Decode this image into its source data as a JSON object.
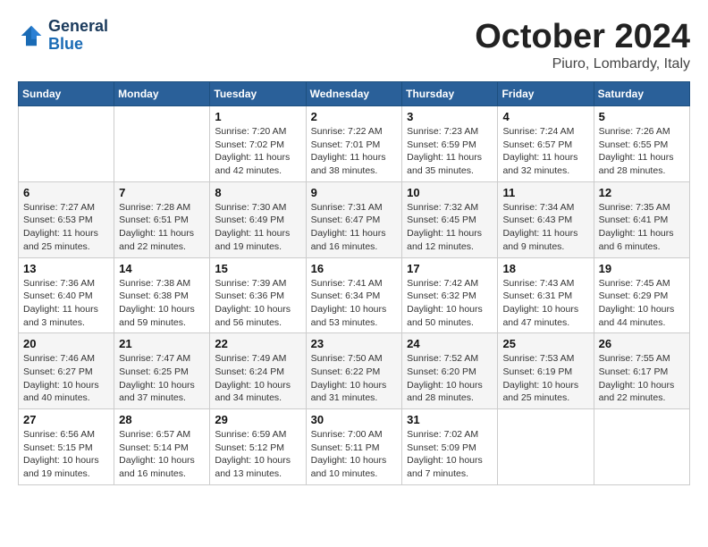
{
  "header": {
    "logo_line1": "General",
    "logo_line2": "Blue",
    "month_title": "October 2024",
    "location": "Piuro, Lombardy, Italy"
  },
  "calendar": {
    "days_of_week": [
      "Sunday",
      "Monday",
      "Tuesday",
      "Wednesday",
      "Thursday",
      "Friday",
      "Saturday"
    ],
    "weeks": [
      [
        {
          "day": "",
          "info": ""
        },
        {
          "day": "",
          "info": ""
        },
        {
          "day": "1",
          "info": "Sunrise: 7:20 AM\nSunset: 7:02 PM\nDaylight: 11 hours and 42 minutes."
        },
        {
          "day": "2",
          "info": "Sunrise: 7:22 AM\nSunset: 7:01 PM\nDaylight: 11 hours and 38 minutes."
        },
        {
          "day": "3",
          "info": "Sunrise: 7:23 AM\nSunset: 6:59 PM\nDaylight: 11 hours and 35 minutes."
        },
        {
          "day": "4",
          "info": "Sunrise: 7:24 AM\nSunset: 6:57 PM\nDaylight: 11 hours and 32 minutes."
        },
        {
          "day": "5",
          "info": "Sunrise: 7:26 AM\nSunset: 6:55 PM\nDaylight: 11 hours and 28 minutes."
        }
      ],
      [
        {
          "day": "6",
          "info": "Sunrise: 7:27 AM\nSunset: 6:53 PM\nDaylight: 11 hours and 25 minutes."
        },
        {
          "day": "7",
          "info": "Sunrise: 7:28 AM\nSunset: 6:51 PM\nDaylight: 11 hours and 22 minutes."
        },
        {
          "day": "8",
          "info": "Sunrise: 7:30 AM\nSunset: 6:49 PM\nDaylight: 11 hours and 19 minutes."
        },
        {
          "day": "9",
          "info": "Sunrise: 7:31 AM\nSunset: 6:47 PM\nDaylight: 11 hours and 16 minutes."
        },
        {
          "day": "10",
          "info": "Sunrise: 7:32 AM\nSunset: 6:45 PM\nDaylight: 11 hours and 12 minutes."
        },
        {
          "day": "11",
          "info": "Sunrise: 7:34 AM\nSunset: 6:43 PM\nDaylight: 11 hours and 9 minutes."
        },
        {
          "day": "12",
          "info": "Sunrise: 7:35 AM\nSunset: 6:41 PM\nDaylight: 11 hours and 6 minutes."
        }
      ],
      [
        {
          "day": "13",
          "info": "Sunrise: 7:36 AM\nSunset: 6:40 PM\nDaylight: 11 hours and 3 minutes."
        },
        {
          "day": "14",
          "info": "Sunrise: 7:38 AM\nSunset: 6:38 PM\nDaylight: 10 hours and 59 minutes."
        },
        {
          "day": "15",
          "info": "Sunrise: 7:39 AM\nSunset: 6:36 PM\nDaylight: 10 hours and 56 minutes."
        },
        {
          "day": "16",
          "info": "Sunrise: 7:41 AM\nSunset: 6:34 PM\nDaylight: 10 hours and 53 minutes."
        },
        {
          "day": "17",
          "info": "Sunrise: 7:42 AM\nSunset: 6:32 PM\nDaylight: 10 hours and 50 minutes."
        },
        {
          "day": "18",
          "info": "Sunrise: 7:43 AM\nSunset: 6:31 PM\nDaylight: 10 hours and 47 minutes."
        },
        {
          "day": "19",
          "info": "Sunrise: 7:45 AM\nSunset: 6:29 PM\nDaylight: 10 hours and 44 minutes."
        }
      ],
      [
        {
          "day": "20",
          "info": "Sunrise: 7:46 AM\nSunset: 6:27 PM\nDaylight: 10 hours and 40 minutes."
        },
        {
          "day": "21",
          "info": "Sunrise: 7:47 AM\nSunset: 6:25 PM\nDaylight: 10 hours and 37 minutes."
        },
        {
          "day": "22",
          "info": "Sunrise: 7:49 AM\nSunset: 6:24 PM\nDaylight: 10 hours and 34 minutes."
        },
        {
          "day": "23",
          "info": "Sunrise: 7:50 AM\nSunset: 6:22 PM\nDaylight: 10 hours and 31 minutes."
        },
        {
          "day": "24",
          "info": "Sunrise: 7:52 AM\nSunset: 6:20 PM\nDaylight: 10 hours and 28 minutes."
        },
        {
          "day": "25",
          "info": "Sunrise: 7:53 AM\nSunset: 6:19 PM\nDaylight: 10 hours and 25 minutes."
        },
        {
          "day": "26",
          "info": "Sunrise: 7:55 AM\nSunset: 6:17 PM\nDaylight: 10 hours and 22 minutes."
        }
      ],
      [
        {
          "day": "27",
          "info": "Sunrise: 6:56 AM\nSunset: 5:15 PM\nDaylight: 10 hours and 19 minutes."
        },
        {
          "day": "28",
          "info": "Sunrise: 6:57 AM\nSunset: 5:14 PM\nDaylight: 10 hours and 16 minutes."
        },
        {
          "day": "29",
          "info": "Sunrise: 6:59 AM\nSunset: 5:12 PM\nDaylight: 10 hours and 13 minutes."
        },
        {
          "day": "30",
          "info": "Sunrise: 7:00 AM\nSunset: 5:11 PM\nDaylight: 10 hours and 10 minutes."
        },
        {
          "day": "31",
          "info": "Sunrise: 7:02 AM\nSunset: 5:09 PM\nDaylight: 10 hours and 7 minutes."
        },
        {
          "day": "",
          "info": ""
        },
        {
          "day": "",
          "info": ""
        }
      ]
    ]
  }
}
